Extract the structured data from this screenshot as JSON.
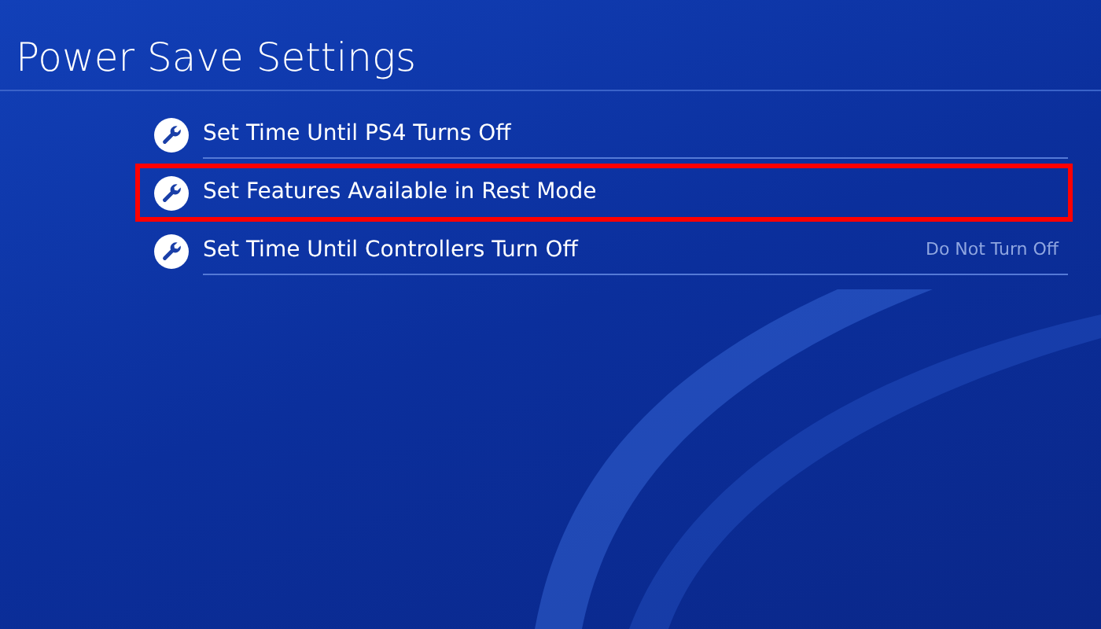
{
  "title": "Power Save Settings",
  "items": [
    {
      "label": "Set Time Until PS4 Turns Off",
      "selected": false
    },
    {
      "label": "Set Features Available in Rest Mode",
      "selected": true
    },
    {
      "label": "Set Time Until Controllers Turn Off",
      "selected": false,
      "value": "Do Not Turn Off"
    }
  ]
}
